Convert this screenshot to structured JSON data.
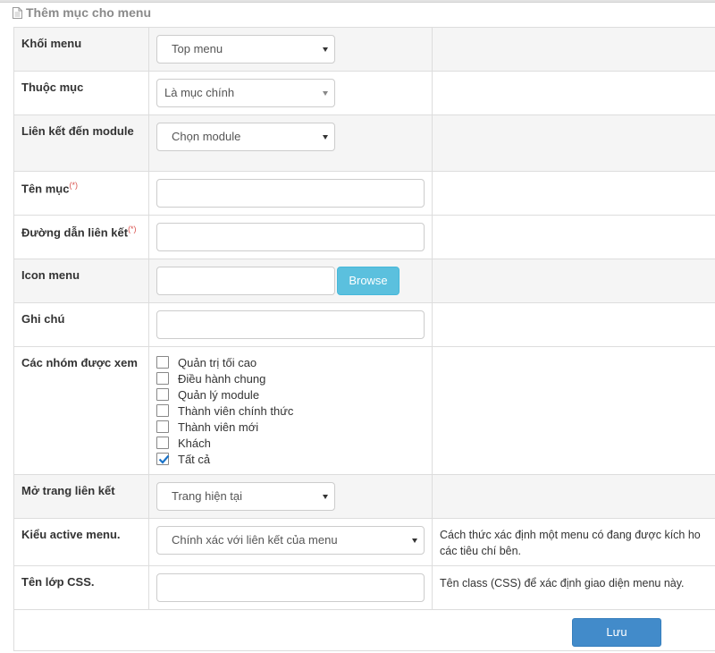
{
  "panel": {
    "title": "Thêm mục cho menu",
    "icon": "document-icon"
  },
  "fields": {
    "menu_block": {
      "label": "Khối menu",
      "value": "Top menu"
    },
    "parent": {
      "label": "Thuộc mục",
      "value": "Là mục chính"
    },
    "module_link": {
      "label": "Liên kết đến module",
      "value": "Chọn module"
    },
    "item_name": {
      "label": "Tên mục",
      "required_mark": "(*)",
      "value": ""
    },
    "link_path": {
      "label": "Đường dẫn liên kết",
      "required_mark": "(*)",
      "value": ""
    },
    "icon_menu": {
      "label": "Icon menu",
      "value": "",
      "browse_label": "Browse"
    },
    "note": {
      "label": "Ghi chú",
      "value": ""
    },
    "groups": {
      "label": "Các nhóm được xem",
      "options": [
        {
          "label": "Quản trị tối cao",
          "checked": false
        },
        {
          "label": "Điều hành chung",
          "checked": false
        },
        {
          "label": "Quản lý module",
          "checked": false
        },
        {
          "label": "Thành viên chính thức",
          "checked": false
        },
        {
          "label": "Thành viên mới",
          "checked": false
        },
        {
          "label": "Khách",
          "checked": false
        },
        {
          "label": "Tất cả",
          "checked": true
        }
      ]
    },
    "open_link": {
      "label": "Mở trang liên kết",
      "value": "Trang hiện tại"
    },
    "active_type": {
      "label": "Kiểu active menu.",
      "value": "Chính xác với liên kết của menu",
      "help_line1": "Cách thức xác định một menu có đang được kích ho",
      "help_line2": "các tiêu chí bên."
    },
    "css_class": {
      "label": "Tên lớp CSS.",
      "value": "",
      "help": "Tên class (CSS) để xác định giao diện menu này."
    }
  },
  "actions": {
    "save_label": "Lưu"
  },
  "colors": {
    "accent": "#428bca",
    "browse": "#5bc0de",
    "required": "#d9534f",
    "check": "#1a73c8"
  }
}
